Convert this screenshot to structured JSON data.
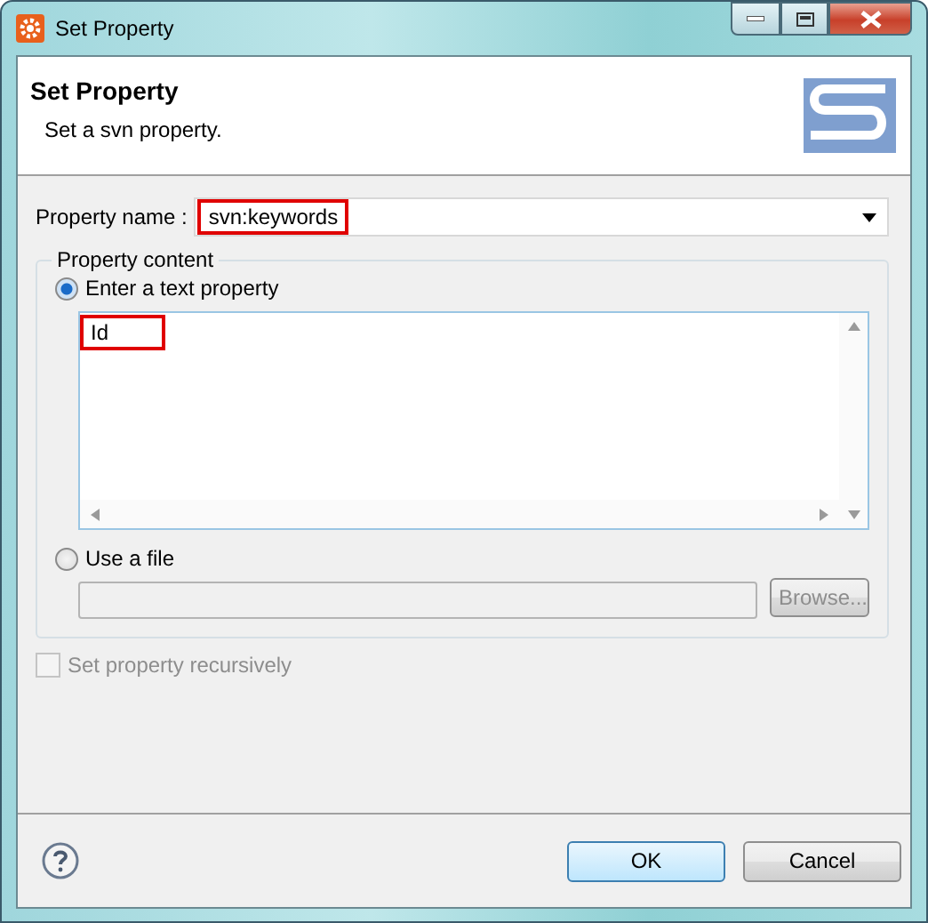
{
  "window": {
    "title": "Set Property"
  },
  "header": {
    "title": "Set Property",
    "description": "Set a svn property."
  },
  "property_name": {
    "label": "Property name :",
    "value": "svn:keywords",
    "highlighted": true
  },
  "content_group": {
    "legend": "Property content",
    "text_option": {
      "label": "Enter a text property",
      "selected": true
    },
    "text_value": "Id",
    "text_highlighted": true,
    "file_option": {
      "label": "Use a file",
      "selected": false
    },
    "file_field": {
      "disabled": true
    },
    "browse_button": {
      "label": "Browse...",
      "disabled": true
    }
  },
  "recursive": {
    "label": "Set property recursively",
    "checked": false,
    "disabled": true
  },
  "buttons": [
    {
      "label": "OK",
      "default": true
    },
    {
      "label": "Cancel",
      "default": false
    }
  ]
}
